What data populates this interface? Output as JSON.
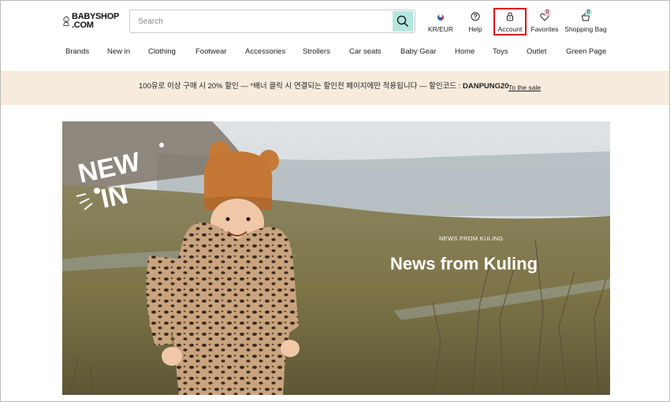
{
  "logo": {
    "line1": "BABYSHOP",
    "line2": ".COM"
  },
  "search": {
    "placeholder": "Search",
    "value": ""
  },
  "header_actions": [
    {
      "label": "KR/EUR",
      "icon": "korea-flag-icon"
    },
    {
      "label": "Help",
      "icon": "help-icon"
    },
    {
      "label": "Account",
      "icon": "lock-icon"
    },
    {
      "label": "Favorites",
      "icon": "heart-icon",
      "count": "0"
    },
    {
      "label": "Shopping Bag",
      "icon": "bag-icon",
      "count": "0"
    }
  ],
  "nav": [
    "Brands",
    "New in",
    "Clothing",
    "Footwear",
    "Accessories",
    "Strollers",
    "Car seats",
    "Baby Gear",
    "Home",
    "Toys",
    "Outlet",
    "Green Page"
  ],
  "promo": {
    "text": "100유로 이상 구매 시 20% 할인 — *배너 클릭 시 연결되는 할인전 페이지에만 적용됩니다 — 할인코드 : ",
    "code": "DANPUNG20",
    "link": "To the sale"
  },
  "hero": {
    "badge_line1": "NEW",
    "badge_line2": "IN",
    "eyebrow": "NEWS FROM KULING",
    "headline": "News from Kuling"
  },
  "colors": {
    "accent": "#b5e7e0",
    "promo_bg": "#f6ebdd",
    "highlight_border": "#dd1111",
    "favorites_badge": "#f3c9d0",
    "bag_badge": "#b5e7e0"
  }
}
